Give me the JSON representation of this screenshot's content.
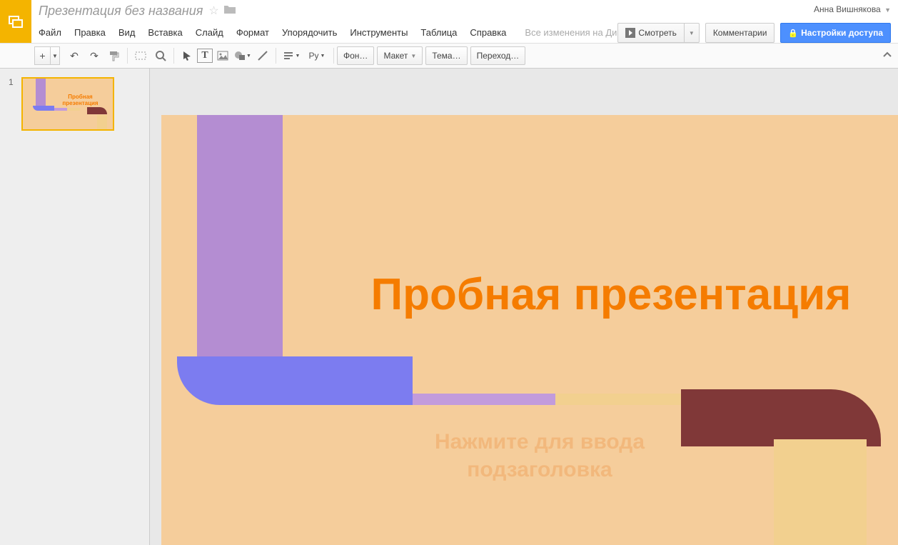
{
  "header": {
    "doc_title": "Презентация без названия",
    "user_name": "Анна Вишнякова"
  },
  "menu": {
    "file": "Файл",
    "edit": "Правка",
    "view": "Вид",
    "insert": "Вставка",
    "slide": "Слайд",
    "format": "Формат",
    "arrange": "Упорядочить",
    "tools": "Инструменты",
    "table": "Таблица",
    "help": "Справка",
    "save_status": "Все изменения на Диске …"
  },
  "actions": {
    "present": "Смотреть",
    "comments": "Комментарии",
    "share": "Настройки доступа"
  },
  "toolbar": {
    "script_label": "Ру",
    "background": "Фон…",
    "layout": "Макет",
    "theme": "Тема…",
    "transition": "Переход…"
  },
  "thumbs": {
    "num1": "1",
    "t1_title": "Пробная презентация"
  },
  "slide": {
    "title": "Пробная презентация",
    "subtitle": "Нажмите для ввода подзаголовка"
  },
  "colors": {
    "accent": "#f4b400",
    "slide_bg": "#f5cd9b",
    "title": "#f57c00",
    "purple": "#b48dd2",
    "blue": "#7c7cf0",
    "brown": "#803838",
    "yellow": "#f2d08f"
  }
}
